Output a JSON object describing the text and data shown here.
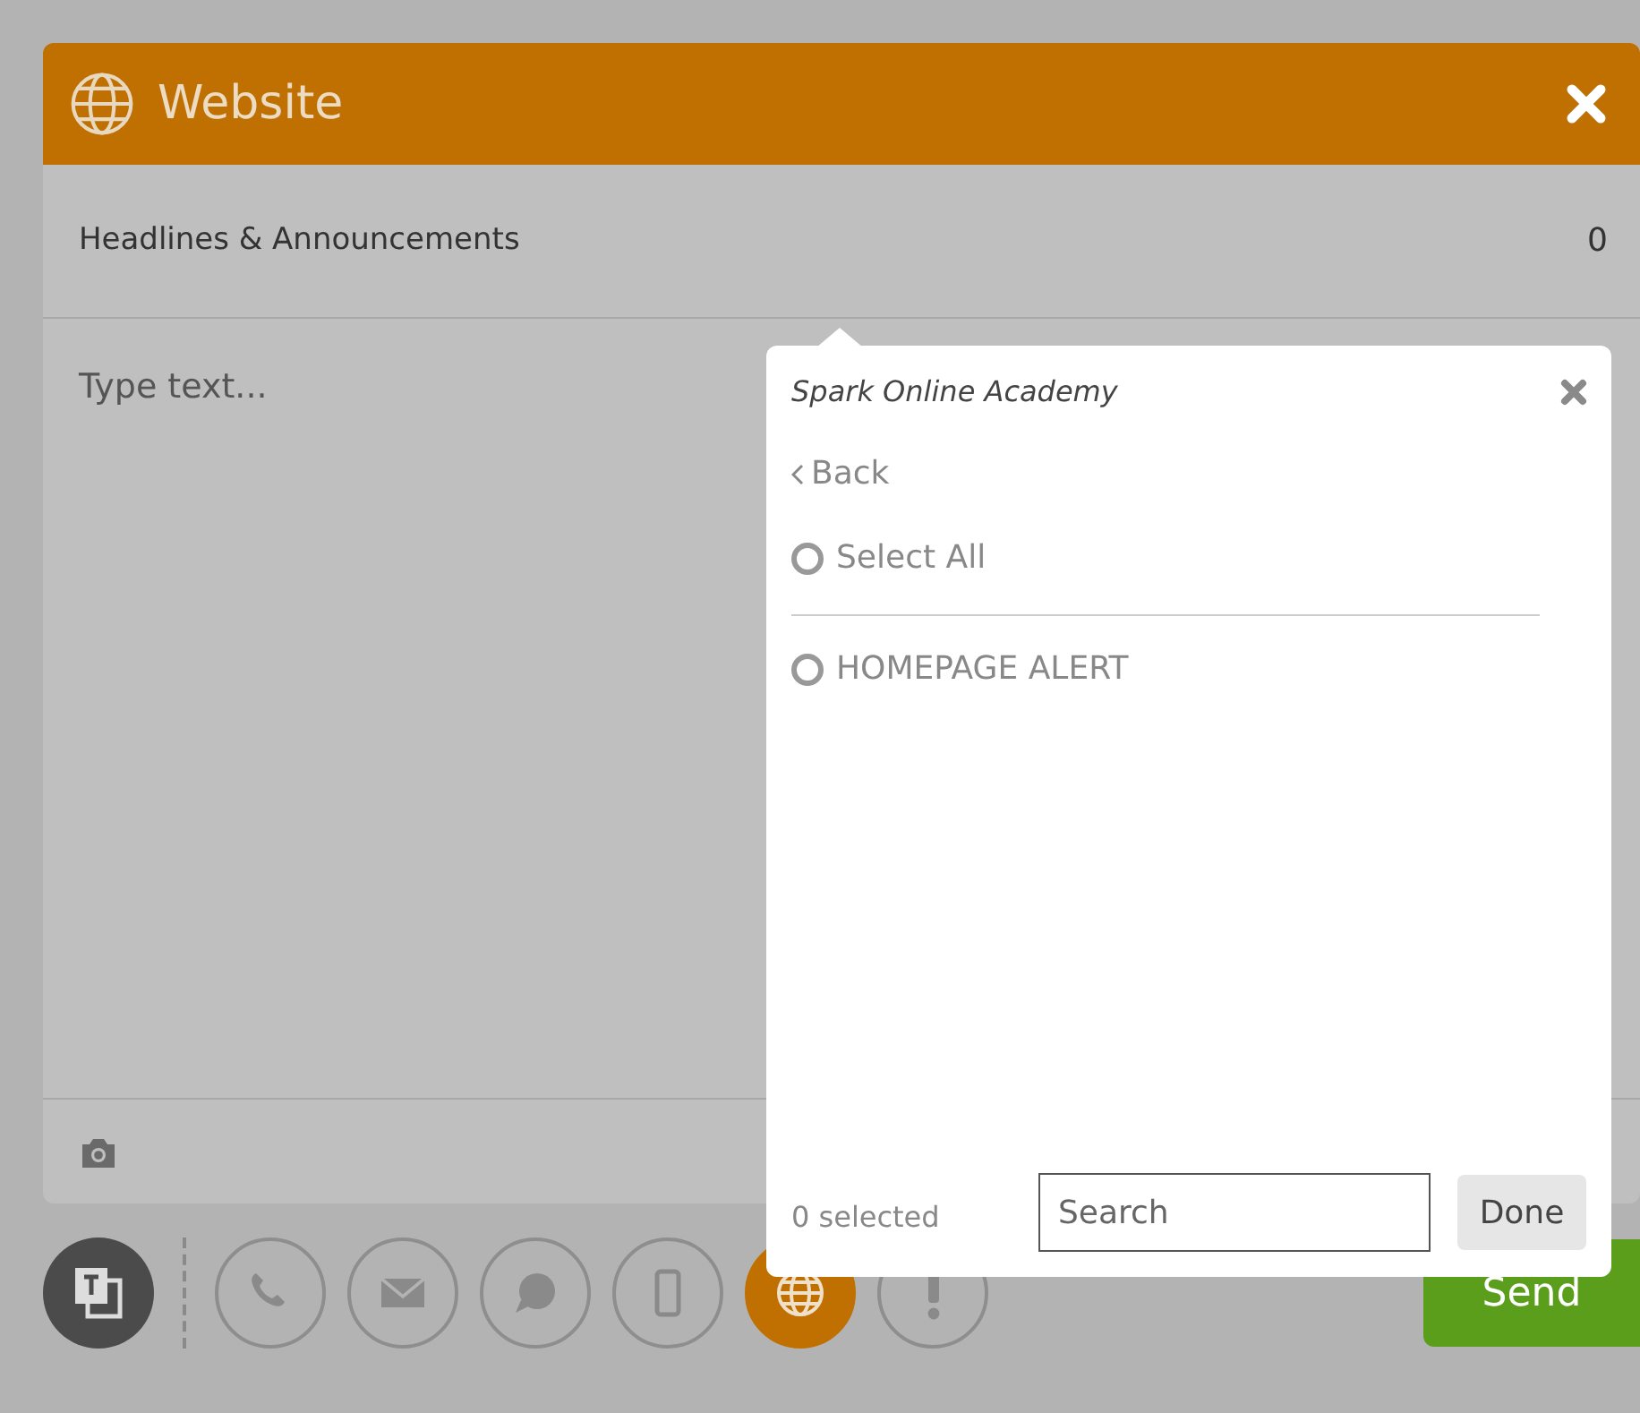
{
  "header": {
    "title": "Website"
  },
  "category": {
    "label": "Headlines & Announcements",
    "count": "0"
  },
  "message": {
    "placeholder": "Type text..."
  },
  "popover": {
    "title": "Spark Online Academy",
    "back": "Back",
    "select_all": {
      "label": "Select All",
      "checked": false
    },
    "options": [
      {
        "label": "HOMEPAGE ALERT",
        "checked": false
      }
    ],
    "selected_count": "0 selected",
    "search": {
      "placeholder": "Search"
    },
    "done": "Done"
  },
  "channels": [
    {
      "kind": "phone",
      "selected": false
    },
    {
      "kind": "email",
      "selected": false
    },
    {
      "kind": "chat",
      "selected": false
    },
    {
      "kind": "mobile",
      "selected": false
    },
    {
      "kind": "web",
      "selected": true
    },
    {
      "kind": "alert",
      "selected": false
    }
  ],
  "send": "Send"
}
